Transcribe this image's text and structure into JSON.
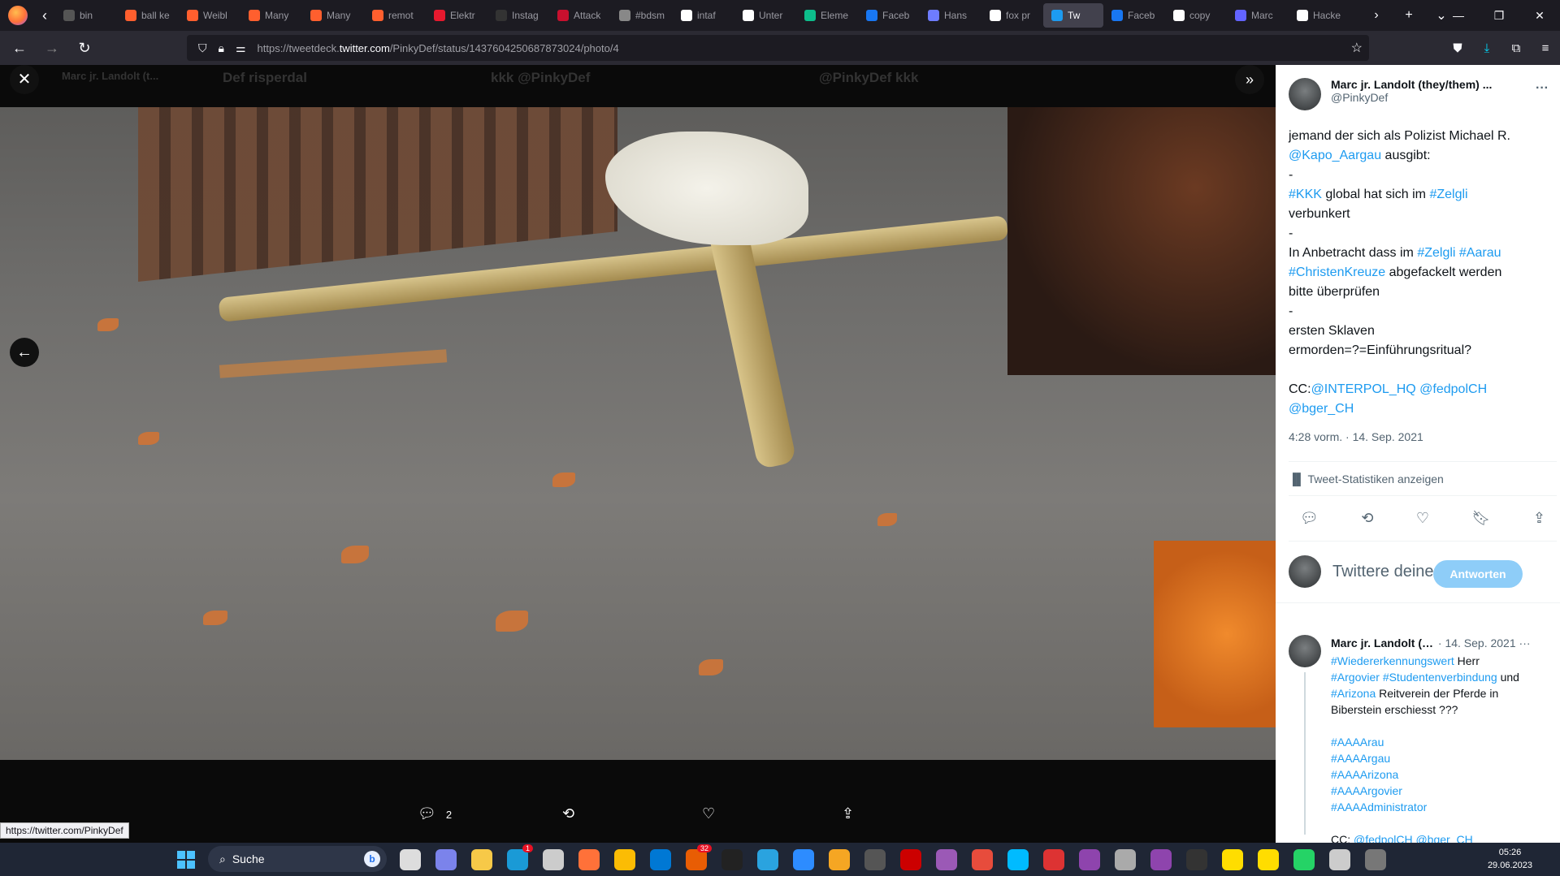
{
  "browser": {
    "tabs": [
      {
        "label": "bin",
        "color": "#555"
      },
      {
        "label": "ball ke",
        "color": "#ff5f2e"
      },
      {
        "label": "Weibl",
        "color": "#ff5f2e"
      },
      {
        "label": "Many",
        "color": "#ff5f2e"
      },
      {
        "label": "Many",
        "color": "#ff5f2e"
      },
      {
        "label": "remot",
        "color": "#ff5f2e"
      },
      {
        "label": "Elektr",
        "color": "#e6192e"
      },
      {
        "label": "Instag",
        "color": "#333"
      },
      {
        "label": "Attack",
        "color": "#c8102e"
      },
      {
        "label": "#bdsm",
        "color": "#888"
      },
      {
        "label": "intaf",
        "color": "#fff"
      },
      {
        "label": "Unter",
        "color": "#fff"
      },
      {
        "label": "Eleme",
        "color": "#0dbd8b"
      },
      {
        "label": "Faceb",
        "color": "#1877f2"
      },
      {
        "label": "Hans",
        "color": "#6e7cff"
      },
      {
        "label": "fox pr",
        "color": "#fff"
      },
      {
        "label": "Tw",
        "color": "#1d9bf0",
        "active": true
      },
      {
        "label": "Faceb",
        "color": "#1877f2"
      },
      {
        "label": "copy",
        "color": "#fff"
      },
      {
        "label": "Marc",
        "color": "#6364ff"
      },
      {
        "label": "Hacke",
        "color": "#fff"
      }
    ],
    "url_prefix": "https://tweetdeck.",
    "url_host": "twitter.com",
    "url_path": "/PinkyDef/status/1437604250687873024/photo/4",
    "status_url": "https://twitter.com/PinkyDef"
  },
  "viewer": {
    "bg_headers": [
      "Marc jr. Landolt (t...",
      "Def risperdal",
      "kkk @PinkyDef",
      "@PinkyDef kkk"
    ],
    "reply_count": "2"
  },
  "tweet": {
    "name": "Marc jr. Landolt (they/them) ...",
    "handle": "@PinkyDef",
    "text_segments": [
      {
        "t": "jemand der sich als Polizist Michael R.\n"
      },
      {
        "t": "@Kapo_Aargau",
        "hl": true
      },
      {
        "t": " ausgibt:\n-\n"
      },
      {
        "t": "#KKK",
        "hl": true
      },
      {
        "t": " global hat sich im "
      },
      {
        "t": "#Zelgli",
        "hl": true
      },
      {
        "t": "\nverbunkert\n-\nIn Anbetracht dass im "
      },
      {
        "t": "#Zelgli",
        "hl": true
      },
      {
        "t": " "
      },
      {
        "t": "#Aarau",
        "hl": true
      },
      {
        "t": "\n"
      },
      {
        "t": "#ChristenKreuze",
        "hl": true
      },
      {
        "t": " abgefackelt werden\nbitte überprüfen\n-\nersten Sklaven\nermorden=?=Einführungsritual?\n\nCC:"
      },
      {
        "t": "@INTERPOL_HQ",
        "hl": true
      },
      {
        "t": " "
      },
      {
        "t": "@fedpolCH",
        "hl": true
      },
      {
        "t": "\n"
      },
      {
        "t": "@bger_CH",
        "hl": true
      }
    ],
    "timestamp": "4:28 vorm. · 14. Sep. 2021",
    "stats_label": "Tweet-Statistiken anzeigen",
    "reply_placeholder": "Twittere deine",
    "reply_button": "Antworten"
  },
  "reply": {
    "name": "Marc jr. Landolt (t...",
    "date": " · 14. Sep. 2021",
    "body_segments": [
      {
        "t": "#Wiedererkennungswert",
        "hl": true
      },
      {
        "t": " Herr\n"
      },
      {
        "t": "#Argovier",
        "hl": true
      },
      {
        "t": " "
      },
      {
        "t": "#Studentenverbindung",
        "hl": true
      },
      {
        "t": " und\n"
      },
      {
        "t": "#Arizona",
        "hl": true
      },
      {
        "t": " Reitverein der Pferde in\nBiberstein erschiesst ???\n\n"
      },
      {
        "t": "#AAAArau\n#AAAArgau\n#AAAArizona\n#AAAArgovier\n#AAAAdministrator",
        "hl": true
      },
      {
        "t": "\n\nCC: "
      },
      {
        "t": "@fedpolCH",
        "hl": true
      },
      {
        "t": " "
      },
      {
        "t": "@bger_CH",
        "hl": true
      }
    ]
  },
  "taskbar": {
    "search_label": "Suche",
    "time": "05:26",
    "date": "29.06.2023",
    "icon_colors": [
      "#ddd",
      "#7b83eb",
      "#f7c948",
      "#1a9ad6",
      "#ccc",
      "#ff7139",
      "#fbbc04",
      "#0078d4",
      "#e85d04",
      "#222",
      "#2aa3df",
      "#2d8cff",
      "#f5a623",
      "#555",
      "#c00",
      "#9b59b6",
      "#e74c3c",
      "#0bf",
      "#d33",
      "#8e44ad",
      "#aaa",
      "#8e44ad",
      "#333",
      "#fd0",
      "#fd0",
      "#25d366",
      "#ccc",
      "#777"
    ],
    "badges": {
      "3": "1",
      "8": "32"
    }
  },
  "colors": {
    "link": "#1d9bf0",
    "panel_bg": "#ffffff",
    "viewer_bg": "#0a0a0a"
  }
}
